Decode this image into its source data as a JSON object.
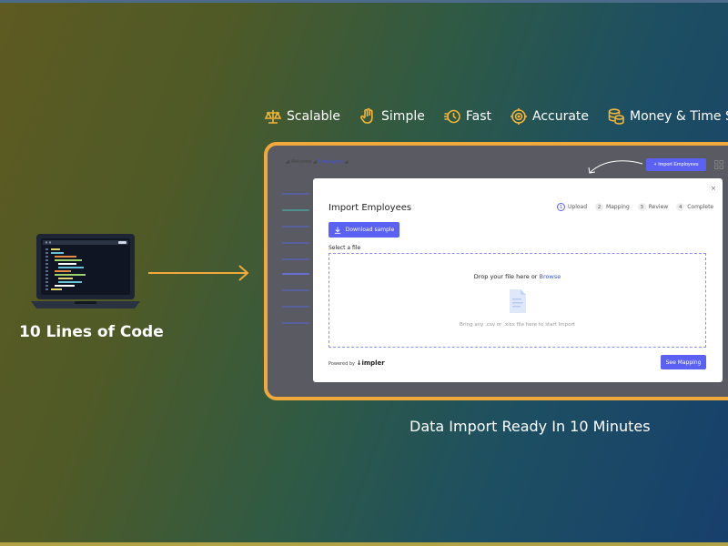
{
  "features": [
    {
      "label": "Scalable",
      "icon": "scale-icon"
    },
    {
      "label": "Simple",
      "icon": "hand-tap-icon"
    },
    {
      "label": "Fast",
      "icon": "speed-clock-icon"
    },
    {
      "label": "Accurate",
      "icon": "target-icon"
    },
    {
      "label": "Money & Time Sa",
      "icon": "coins-icon"
    }
  ],
  "left": {
    "caption": "10 Lines of Code"
  },
  "app": {
    "breadcrumb": {
      "home": "Welcome",
      "current": "Employees"
    },
    "import_button": "+ Import Employees",
    "modal": {
      "title": "Import Employees",
      "close": "×",
      "steps": [
        {
          "num": "1",
          "label": "Upload"
        },
        {
          "num": "2",
          "label": "Mapping"
        },
        {
          "num": "3",
          "label": "Review"
        },
        {
          "num": "4",
          "label": "Complete"
        }
      ],
      "download_button": "Download sample",
      "select_label": "Select a file",
      "drop_text": "Drop your file here or ",
      "browse_link": "Browse",
      "hint": "Bring any .csv or .xlsx file here to start Import",
      "powered_by": "Powered by",
      "brand": "impler",
      "see_mapping": "See Mapping"
    }
  },
  "caption": "Data Import Ready In 10 Minutes",
  "colors": {
    "accent": "#5b61f2",
    "frame": "#f0a93a",
    "feature_icon": "#f2b53a"
  }
}
